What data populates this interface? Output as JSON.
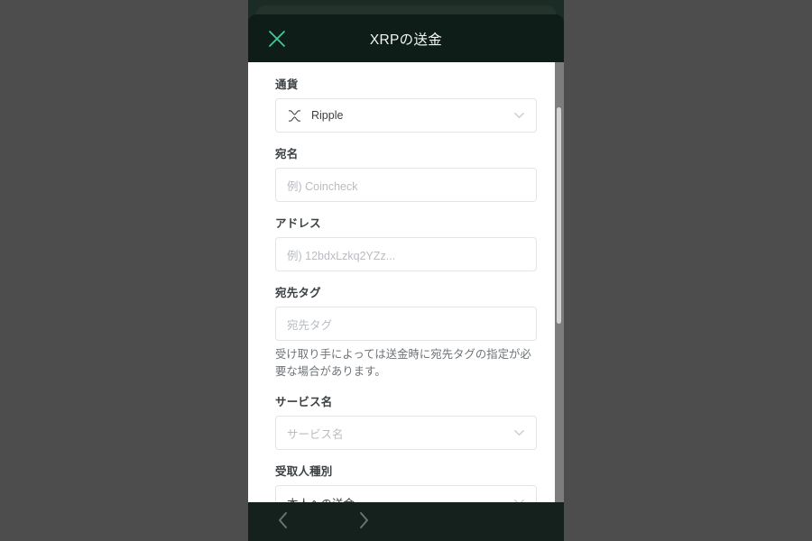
{
  "header": {
    "title": "XRPの送金",
    "close_icon": "close-x-icon",
    "accent_color": "#3ecf9e",
    "background_color": "#0e1d17"
  },
  "form": {
    "fields": [
      {
        "label": "通貨",
        "type": "select",
        "value": "Ripple",
        "placeholder": "",
        "icon": "xrp-coin-icon",
        "has_chevron": true,
        "helper": ""
      },
      {
        "label": "宛名",
        "type": "text",
        "value": "",
        "placeholder": "例) Coincheck",
        "icon": "",
        "has_chevron": false,
        "helper": ""
      },
      {
        "label": "アドレス",
        "type": "text",
        "value": "",
        "placeholder": "例) 12bdxLzkq2YZz...",
        "icon": "",
        "has_chevron": false,
        "helper": ""
      },
      {
        "label": "宛先タグ",
        "type": "text",
        "value": "",
        "placeholder": "宛先タグ",
        "icon": "",
        "has_chevron": false,
        "helper": "受け取り手によっては送金時に宛先タグの指定が必要な場合があります。"
      },
      {
        "label": "サービス名",
        "type": "select",
        "value": "",
        "placeholder": "サービス名",
        "icon": "",
        "has_chevron": true,
        "helper": ""
      },
      {
        "label": "受取人種別",
        "type": "select",
        "value": "本人への送金",
        "placeholder": "",
        "icon": "",
        "has_chevron": true,
        "helper": ""
      }
    ]
  },
  "bottom_nav": {
    "back_icon": "chevron-left-icon",
    "forward_icon": "chevron-right-icon",
    "background_color": "#15211c",
    "icon_color": "#6b7670"
  },
  "page": {
    "background_color": "#4d4d4d",
    "scrollbar_track_color": "#7d7d7d",
    "scrollbar_thumb_color": "#d3d3d3"
  }
}
